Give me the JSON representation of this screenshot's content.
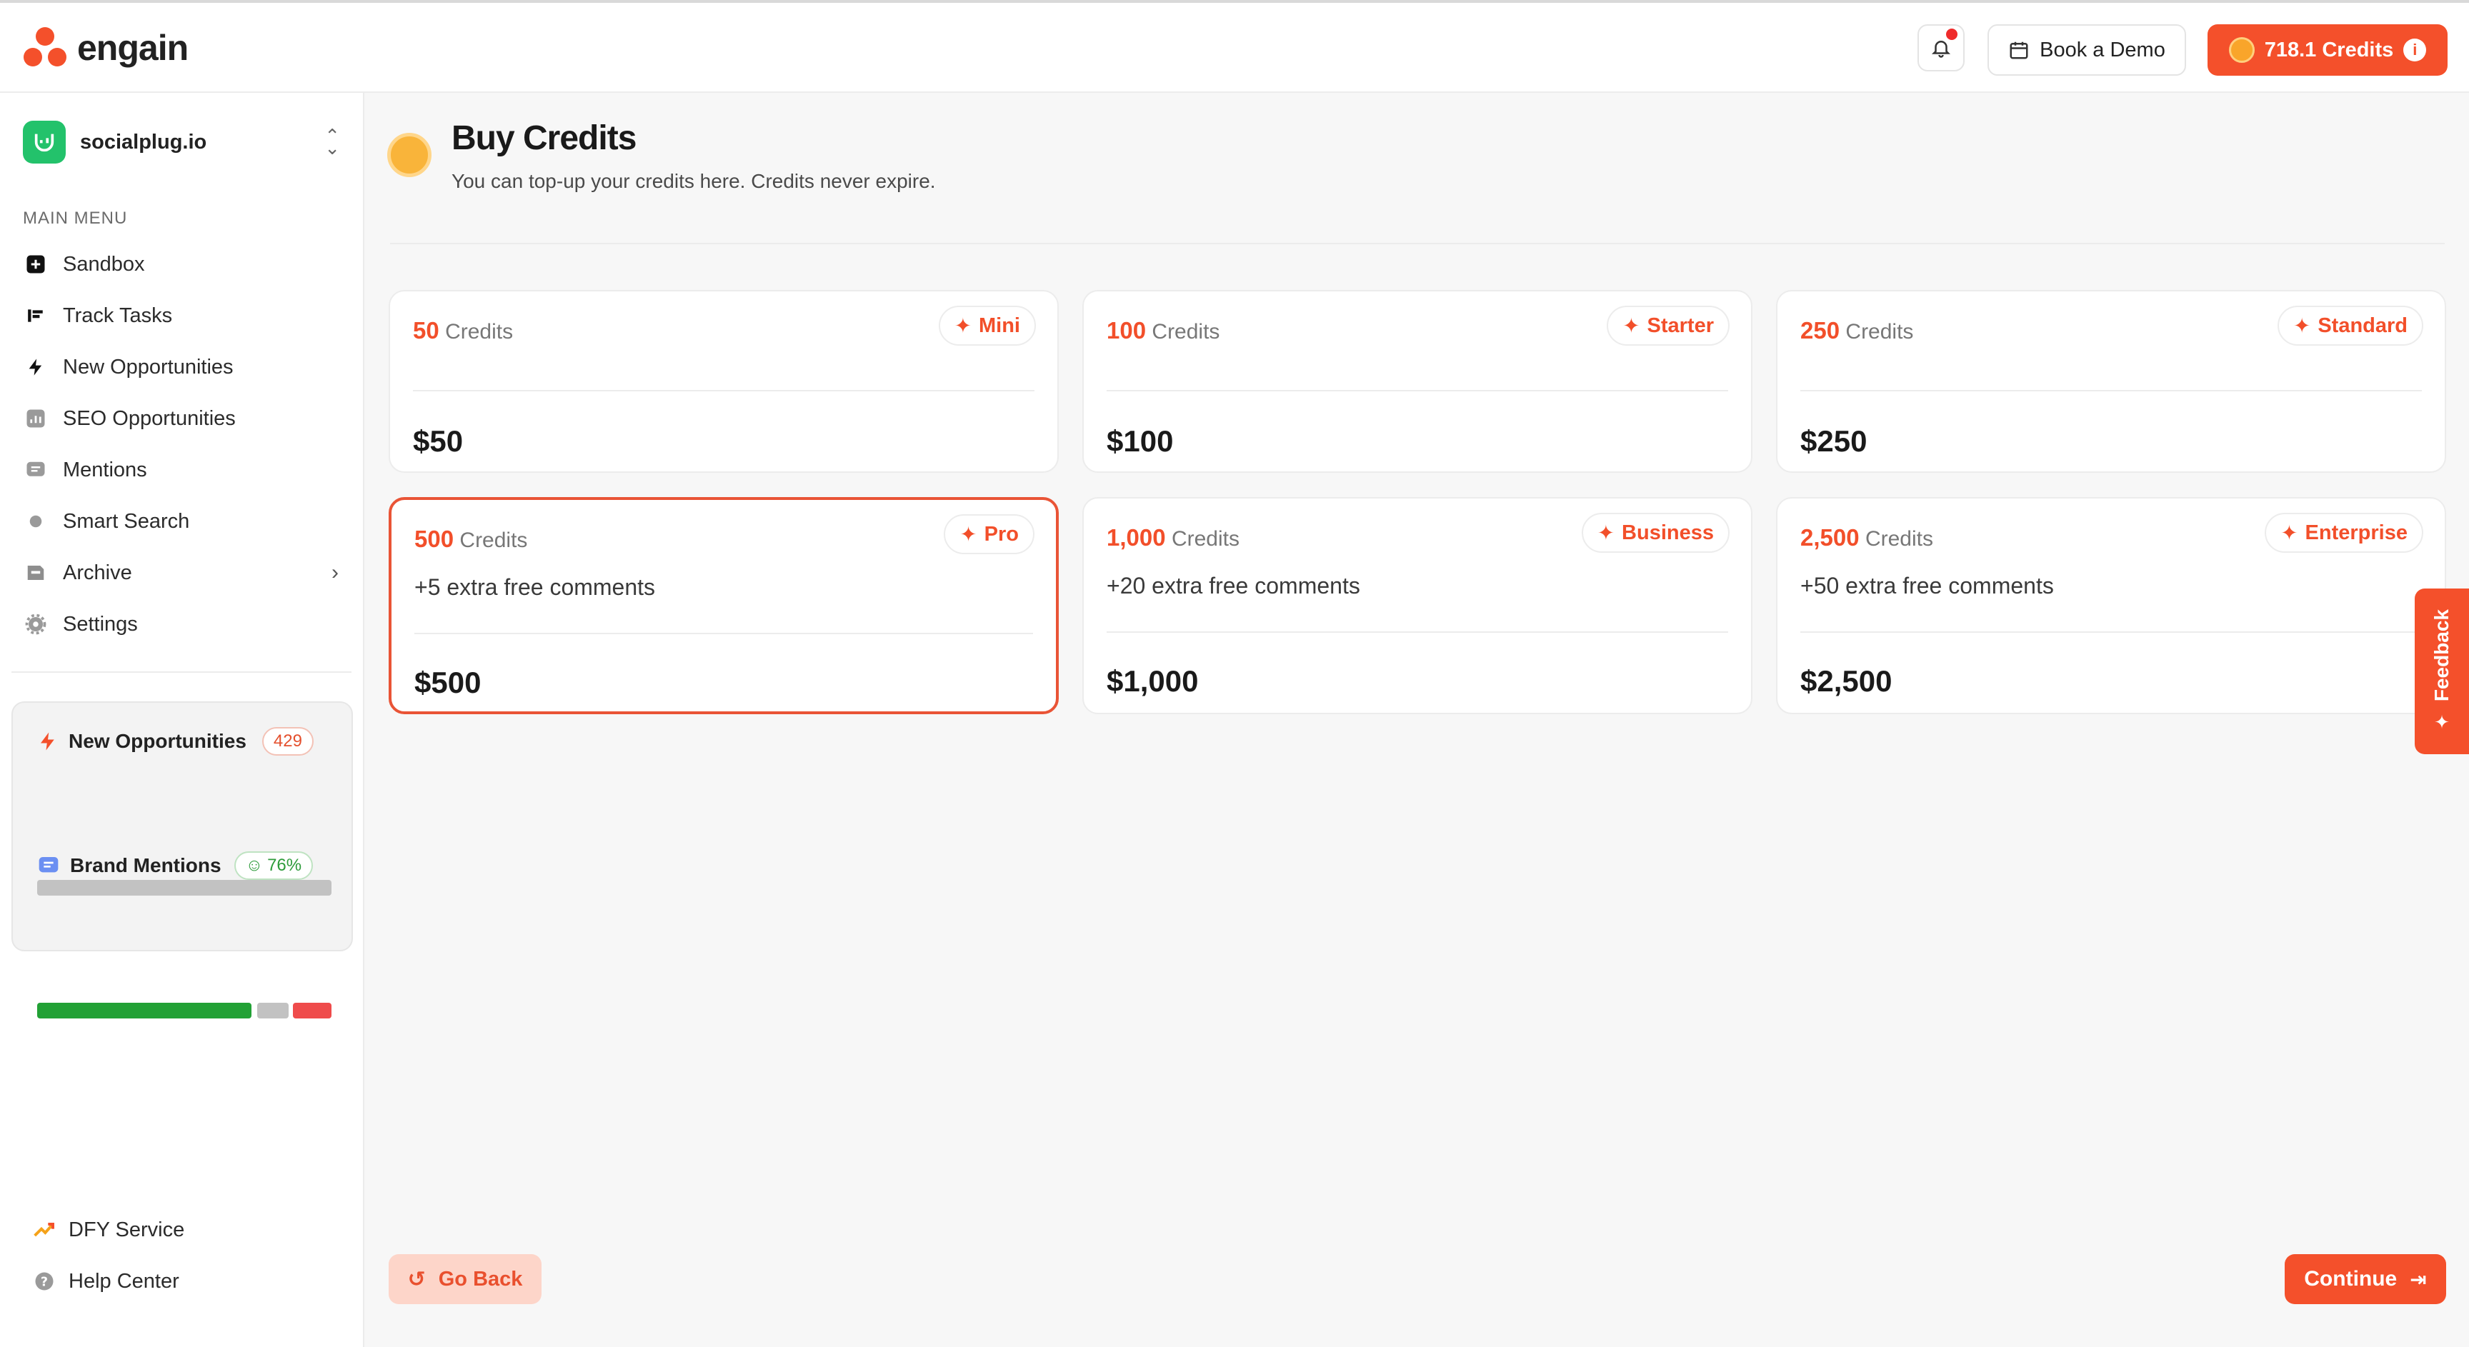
{
  "header": {
    "brand": "engain",
    "book_demo_label": "Book a Demo",
    "credits_label": "718.1 Credits",
    "credits_info": "i"
  },
  "sidebar": {
    "workspace_name": "socialplug.io",
    "menu_title": "MAIN MENU",
    "items": [
      {
        "label": "Sandbox",
        "icon": "plus-square-icon"
      },
      {
        "label": "Track Tasks",
        "icon": "list-icon"
      },
      {
        "label": "New Opportunities",
        "icon": "lightning-icon"
      },
      {
        "label": "SEO Opportunities",
        "icon": "chart-icon"
      },
      {
        "label": "Mentions",
        "icon": "message-icon"
      },
      {
        "label": "Smart Search",
        "icon": "search-dot-icon"
      },
      {
        "label": "Archive",
        "icon": "archive-icon"
      },
      {
        "label": "Settings",
        "icon": "gear-icon"
      }
    ],
    "stats": {
      "new_opps_label": "New Opportunities",
      "new_opps_count": "429",
      "brand_mentions_label": "Brand Mentions",
      "brand_mentions_pct": "76%",
      "colors": {
        "positive": "#22a135",
        "neutral": "#c2c2c2",
        "negative": "#ef4b4b"
      }
    },
    "bottom": [
      {
        "label": "DFY Service",
        "icon": "trend-icon"
      },
      {
        "label": "Help Center",
        "icon": "help-icon"
      }
    ]
  },
  "main": {
    "title": "Buy Credits",
    "subtitle": "You can top-up your credits here. Credits never expire.",
    "credits_word": "Credits",
    "packages": [
      {
        "credits": "50",
        "tag": "Mini",
        "extra": "",
        "price": "$50",
        "selected": false
      },
      {
        "credits": "100",
        "tag": "Starter",
        "extra": "",
        "price": "$100",
        "selected": false
      },
      {
        "credits": "250",
        "tag": "Standard",
        "extra": "",
        "price": "$250",
        "selected": false
      },
      {
        "credits": "500",
        "tag": "Pro",
        "extra": "+5 extra free comments",
        "price": "$500",
        "selected": true
      },
      {
        "credits": "1,000",
        "tag": "Business",
        "extra": "+20 extra free comments",
        "price": "$1,000",
        "selected": false
      },
      {
        "credits": "2,500",
        "tag": "Enterprise",
        "extra": "+50 extra free comments",
        "price": "$2,500",
        "selected": false
      }
    ],
    "go_back_label": "Go Back",
    "continue_label": "Continue",
    "feedback_label": "Feedback",
    "accent_color": "#f4502b"
  }
}
